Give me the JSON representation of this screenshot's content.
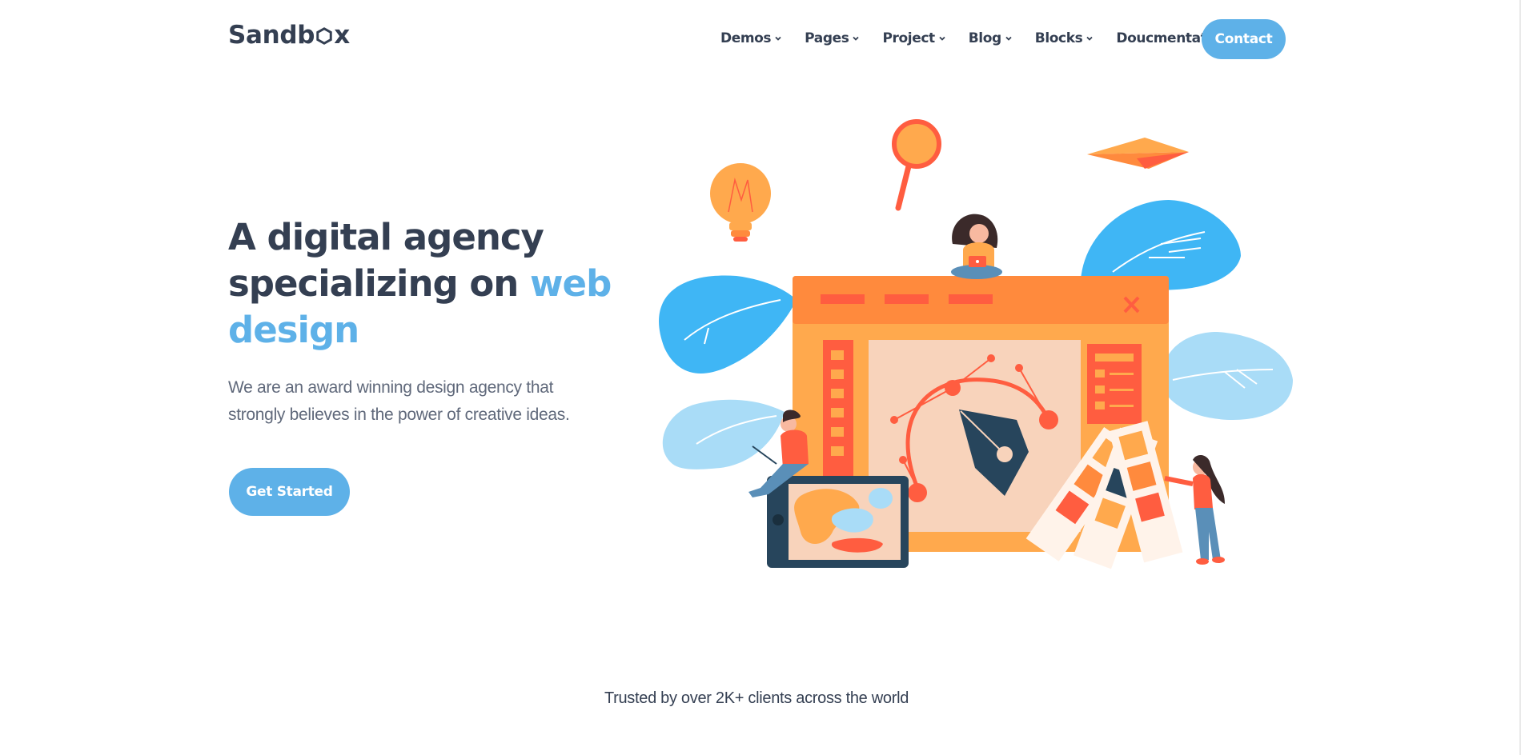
{
  "brand": {
    "name_part1": "Sandb",
    "name_part2": "x"
  },
  "nav": {
    "items": [
      {
        "label": "Demos"
      },
      {
        "label": "Pages"
      },
      {
        "label": "Project"
      },
      {
        "label": "Blog"
      },
      {
        "label": "Blocks"
      },
      {
        "label": "Doucmentation"
      }
    ],
    "contact_label": "Contact"
  },
  "hero": {
    "title_main": "A digital agency specializing on ",
    "title_accent": "web design",
    "lead": "We are an award winning design agency that strongly believes in the power of creative ideas.",
    "cta_label": "Get Started"
  },
  "trusted": {
    "text": "Trusted by over 2K+ clients across the world"
  },
  "colors": {
    "accent": "#5eb1e8",
    "heading": "#343f52",
    "body": "#60697b",
    "illustration_blue": "#3fb6f5",
    "illustration_light_blue": "#a9dcf7",
    "illustration_orange": "#ff8a3d",
    "illustration_yellow": "#ffa94d",
    "illustration_red": "#ff5d40",
    "illustration_navy": "#27455c"
  },
  "icons": [
    "chevron-down-icon",
    "logo-hex-icon",
    "lightbulb-icon",
    "magnifier-icon",
    "paper-plane-icon",
    "pen-nib-icon",
    "close-icon"
  ]
}
